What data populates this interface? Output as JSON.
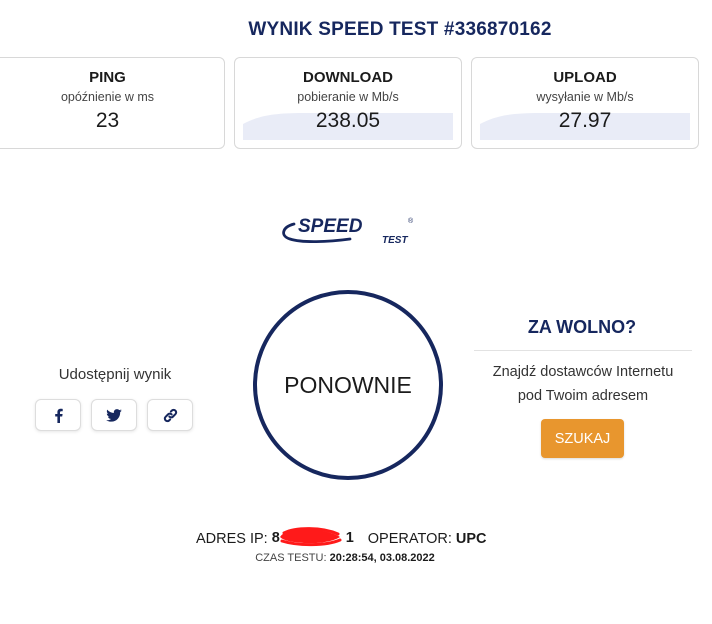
{
  "page_title": "WYNIK SPEED TEST #336870162",
  "metrics": {
    "ping": {
      "label": "PING",
      "sub": "opóźnienie w ms",
      "value": "23"
    },
    "download": {
      "label": "DOWNLOAD",
      "sub": "pobieranie w Mb/s",
      "value": "238.05"
    },
    "upload": {
      "label": "UPLOAD",
      "sub": "wysyłanie w Mb/s",
      "value": "27.97"
    }
  },
  "logo": {
    "text_main": "SPEED",
    "text_sub": "TEST",
    "mark": "®"
  },
  "restart_button": {
    "label": "PONOWNIE"
  },
  "share": {
    "label": "Udostępnij wynik",
    "buttons": [
      {
        "name": "facebook",
        "icon": "facebook-icon"
      },
      {
        "name": "twitter",
        "icon": "twitter-icon"
      },
      {
        "name": "link",
        "icon": "link-icon"
      }
    ]
  },
  "too_slow": {
    "title": "ZA WOLNO?",
    "text_line1": "Znajdź dostawców Internetu",
    "text_line2": "pod Twoim adresem",
    "button_label": "SZUKAJ"
  },
  "connection": {
    "ip_label": "ADRES IP:",
    "ip_value_visible_start": "8",
    "ip_value_visible_end": "1",
    "operator_label": "OPERATOR:",
    "operator_value": "UPC",
    "time_label": "CZAS TESTU:",
    "time_value": "20:28:54, 03.08.2022"
  },
  "colors": {
    "brand_navy": "#16275e",
    "accent_orange": "#e8962e",
    "wave_fill": "#e9ecf7",
    "redaction": "#ff1a1a"
  }
}
